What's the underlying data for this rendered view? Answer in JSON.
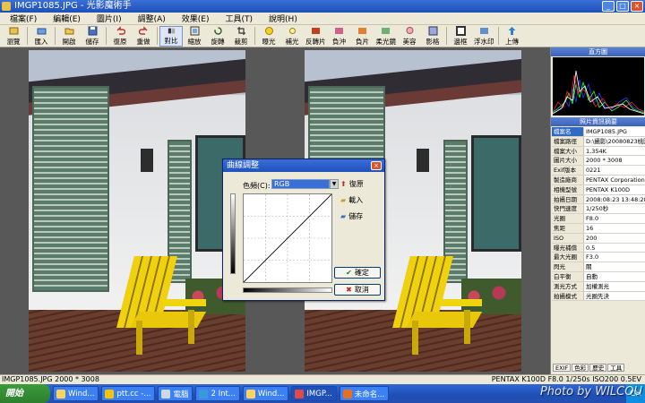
{
  "window": {
    "title": "IMGP1085.JPG - 光影魔術手",
    "minimize": "_",
    "maximize": "□",
    "close": "×"
  },
  "menu": [
    "檔案(F)",
    "編輯(E)",
    "圖片(I)",
    "調整(A)",
    "效果(E)",
    "工具(T)",
    "說明(H)"
  ],
  "toolbar": [
    "瀏覽",
    "匯入",
    "開啟",
    "儲存",
    "復原",
    "重做",
    "對比",
    "縮放",
    "旋轉",
    "裁剪",
    "曝光",
    "補光",
    "反轉片",
    "負沖",
    "負片",
    "柔光鏡",
    "美容",
    "影格",
    "邊框",
    "浮水印",
    "上傳"
  ],
  "dialog": {
    "title": "曲線調整",
    "close": "×",
    "channel_label": "色頻(C):",
    "channel_value": "RGB",
    "buttons": {
      "reset": "復原",
      "load": "載入",
      "save": "儲存",
      "ok": "確定",
      "cancel": "取消"
    }
  },
  "panel": {
    "histogram_title": "直方圖",
    "info_title": "照片資訊摘要",
    "rows": [
      {
        "k": "檔案名",
        "v": "IMGP1085.JPG"
      },
      {
        "k": "檔案路徑",
        "v": "D:\\攝影\\20080823桃園"
      },
      {
        "k": "檔案大小",
        "v": "1,354K"
      },
      {
        "k": "圖片大小",
        "v": "2000 * 3008"
      },
      {
        "k": "Exif版本",
        "v": "0221"
      },
      {
        "k": "製造廠商",
        "v": "PENTAX Corporation"
      },
      {
        "k": "相機型號",
        "v": "PENTAX K100D"
      },
      {
        "k": "拍攝日期",
        "v": "2008:08:23 13:48:28"
      },
      {
        "k": "快門速度",
        "v": "1/250秒"
      },
      {
        "k": "光圈",
        "v": "F8.0"
      },
      {
        "k": "焦距",
        "v": "16"
      },
      {
        "k": "ISO",
        "v": "200"
      },
      {
        "k": "曝光補償",
        "v": "0.5"
      },
      {
        "k": "最大光圈",
        "v": "F3.0"
      },
      {
        "k": "閃光",
        "v": "關"
      },
      {
        "k": "白平衡",
        "v": "自動"
      },
      {
        "k": "測光方式",
        "v": "加權測光"
      },
      {
        "k": "拍攝模式",
        "v": "光圈先決"
      }
    ],
    "tabs": [
      "EXIF",
      "色彩",
      "歷史",
      "工具"
    ]
  },
  "status": {
    "left": "IMGP1085.JPG 2000 * 3008",
    "right": "PENTAX K100D F8.0 1/250s ISO200 0.5EV"
  },
  "taskbar": {
    "start": "開始",
    "tasks": [
      "Wind...",
      "ptt.cc -...",
      "電腦",
      "2 Int...",
      "Wind...",
      "IMGP...",
      "未命名..."
    ],
    "tray": "CH"
  },
  "watermark": "Photo by WILCOU",
  "colors": {
    "accent": "#1d4fb8",
    "dialog_channel": "#3a6fd8",
    "chair_yellow": "#f1d10d"
  }
}
